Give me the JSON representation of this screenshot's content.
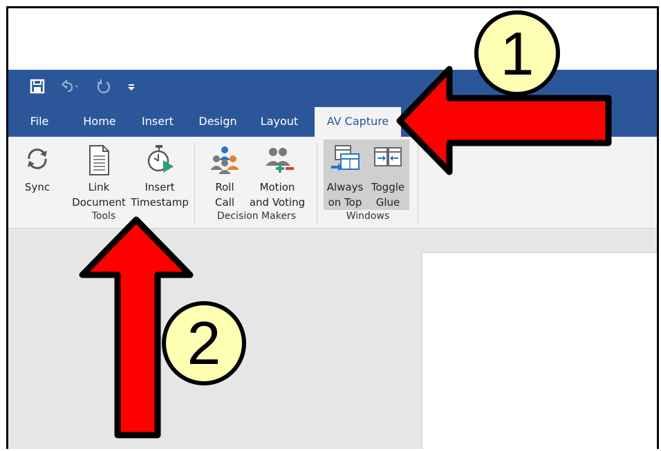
{
  "qat": {
    "save_icon": "save-icon",
    "undo_icon": "undo-icon",
    "redo_icon": "redo-icon",
    "customize_icon": "customize-qat-icon"
  },
  "tabs": [
    {
      "label": "File"
    },
    {
      "label": "Home"
    },
    {
      "label": "Insert"
    },
    {
      "label": "Design"
    },
    {
      "label": "Layout"
    },
    {
      "label": "AV Capture",
      "active": true
    }
  ],
  "ribbon": {
    "groups": [
      {
        "label": "Tools",
        "buttons": [
          {
            "line1": "Sync",
            "line2": "",
            "icon": "sync-icon"
          },
          {
            "line1": "Link",
            "line2": "Document",
            "icon": "document-icon"
          },
          {
            "line1": "Insert",
            "line2": "Timestamp",
            "icon": "stopwatch-play-icon"
          }
        ]
      },
      {
        "label": "Decision Makers",
        "buttons": [
          {
            "line1": "Roll",
            "line2": "Call",
            "icon": "people-group-icon"
          },
          {
            "line1": "Motion",
            "line2": "and Voting",
            "icon": "people-vote-icon"
          }
        ]
      },
      {
        "label": "Windows",
        "buttons": [
          {
            "line1": "Always",
            "line2": "on Top",
            "icon": "window-pin-icon",
            "pressed": true
          },
          {
            "line1": "Toggle",
            "line2": "Glue",
            "icon": "glue-windows-icon",
            "pressed": true
          }
        ]
      }
    ]
  },
  "annotations": {
    "callout_1": "1",
    "callout_2": "2",
    "arrow_color": "#ff0000",
    "badge_color": "#ffffb3"
  },
  "colors": {
    "accent": "#2b579a",
    "ribbon_bg": "#f3f3f3",
    "workspace_bg": "#e6e6e6"
  }
}
